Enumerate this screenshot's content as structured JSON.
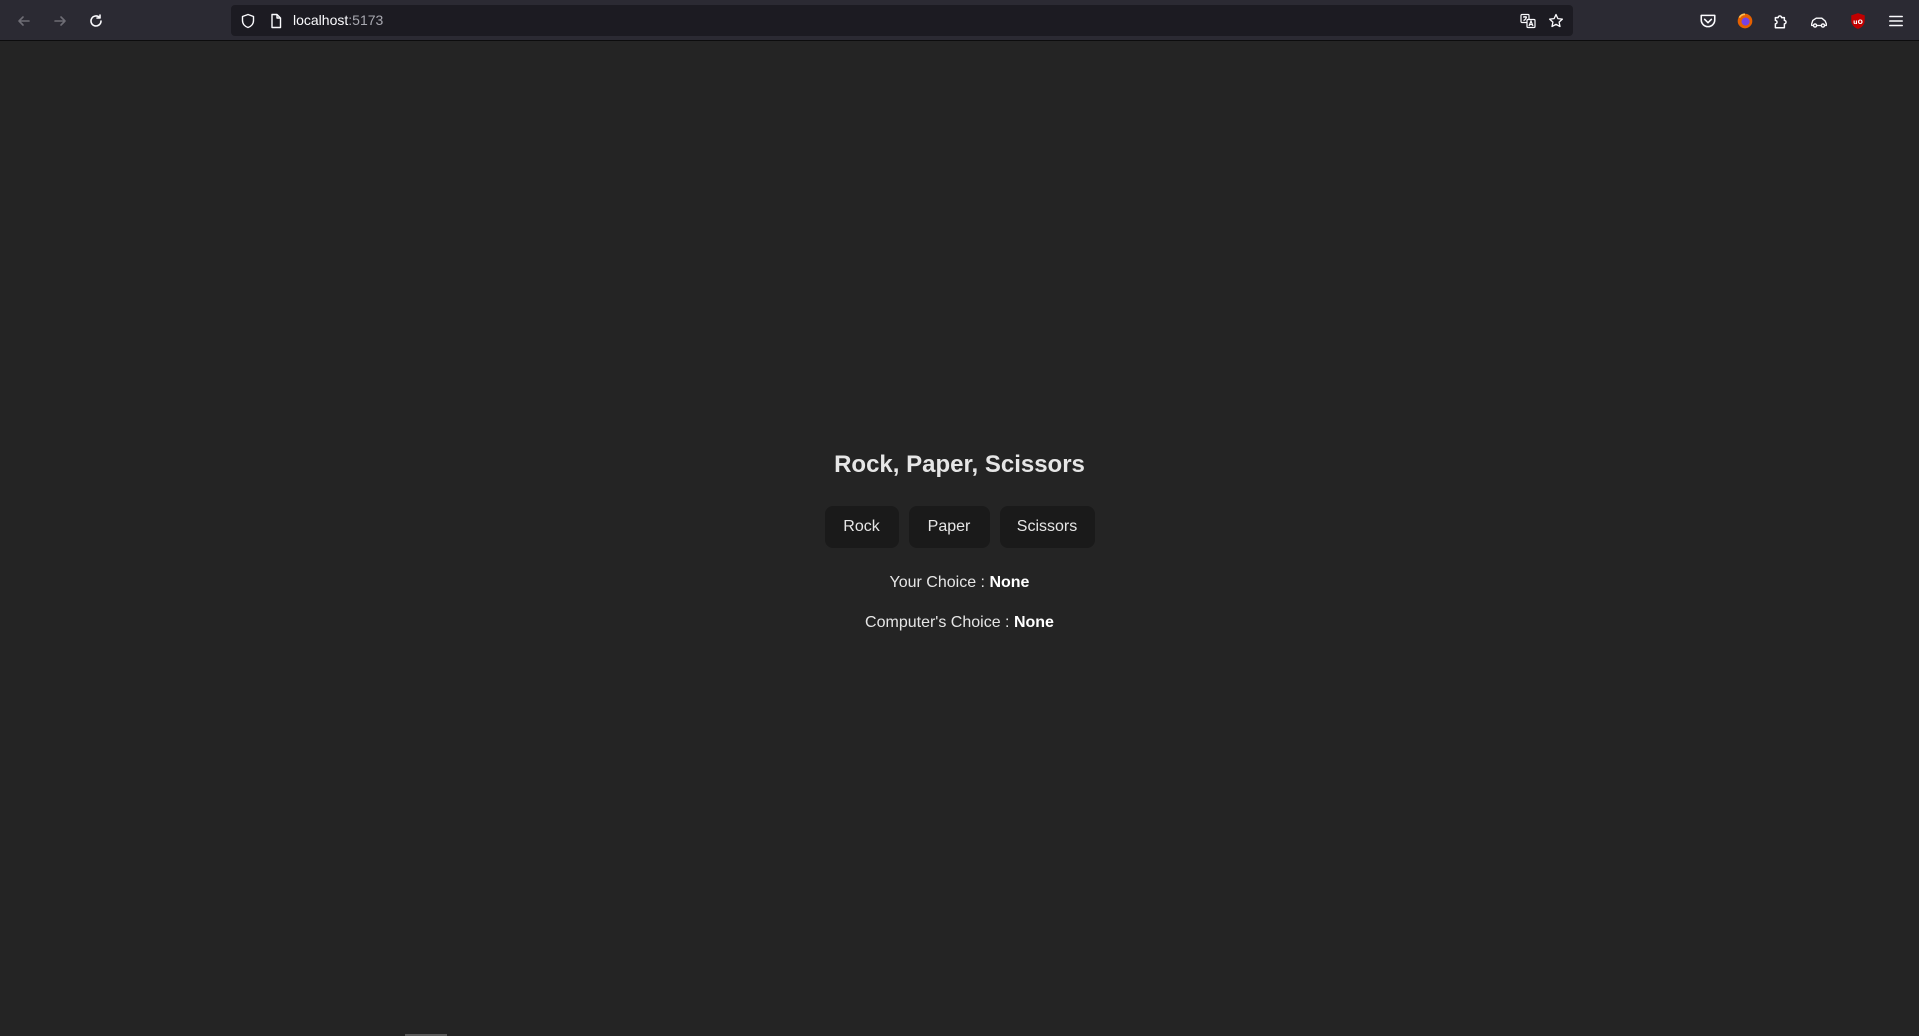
{
  "browser": {
    "url_host": "localhost",
    "url_port": ":5173",
    "icons": {
      "back": "arrow-left-icon",
      "forward": "arrow-right-icon",
      "reload": "reload-icon",
      "tracking": "shield-icon",
      "page": "page-icon",
      "translate": "translate-icon",
      "bookmark": "star-icon",
      "pocket": "pocket-icon",
      "account": "firefox-account-icon",
      "extensions": "puzzle-icon",
      "extension_car": "car-extension-icon",
      "ublock": "ublock-icon",
      "menu": "hamburger-menu-icon"
    },
    "colors": {
      "toolbar": "#2b2a33",
      "urlbar": "#1c1b22",
      "ublock": "#c00000"
    }
  },
  "app": {
    "title": "Rock, Paper, Scissors",
    "buttons": {
      "rock": "Rock",
      "paper": "Paper",
      "scissors": "Scissors"
    },
    "your_choice_label": "Your Choice : ",
    "your_choice_value": "None",
    "computer_choice_label": "Computer's Choice : ",
    "computer_choice_value": "None",
    "colors": {
      "background": "#242424",
      "button": "#1a1a1a",
      "text": "#e6e6e6"
    }
  }
}
